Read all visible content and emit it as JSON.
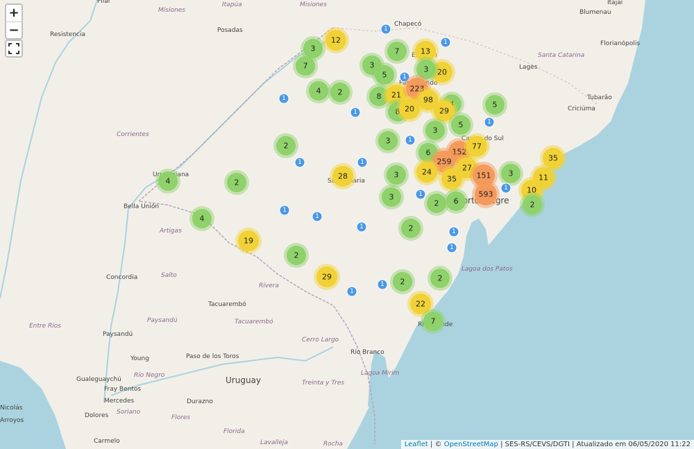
{
  "controls": {
    "zoom_in": "+",
    "zoom_out": "−"
  },
  "attribution": {
    "leaflet": "Leaflet",
    "sep1": " | © ",
    "osm": "OpenStreetMap",
    "rest": " | SES-RS/CEVS/DGTI | Atualizado em 06/05/2020 11:22"
  },
  "colors": {
    "green": "#8fd16a",
    "yellow": "#f1d236",
    "orange": "#f49a5b",
    "blue": "#4a98e6",
    "sea": "#aad3df",
    "land": "#f2efe9"
  },
  "places": [
    {
      "name": "Pilar",
      "style": "n"
    },
    {
      "name": "Misiones",
      "style": "it"
    },
    {
      "name": "Itapúa",
      "style": "it"
    },
    {
      "name": "Misiones",
      "style": "it"
    },
    {
      "name": "Chapecó",
      "style": "n"
    },
    {
      "name": "Itajaí",
      "style": "n"
    },
    {
      "name": "Blumenau",
      "style": "n"
    },
    {
      "name": "Resistencia",
      "style": "n"
    },
    {
      "name": "Posadas",
      "style": "n"
    },
    {
      "name": "Florianópolis",
      "style": "n"
    },
    {
      "name": "Santa Catarina",
      "style": "it"
    },
    {
      "name": "Lages",
      "style": "n"
    },
    {
      "name": "Tubarão",
      "style": "n"
    },
    {
      "name": "Criciúma",
      "style": "n"
    },
    {
      "name": "Corrientes",
      "style": "it"
    },
    {
      "name": "Caxias do Sul",
      "style": "n"
    },
    {
      "name": "Bella Unión",
      "style": "n"
    },
    {
      "name": "Porto Alegre",
      "style": "big"
    },
    {
      "name": "Artigas",
      "style": "it"
    },
    {
      "name": "Concordia",
      "style": "n"
    },
    {
      "name": "Salto",
      "style": "it"
    },
    {
      "name": "Rivera",
      "style": "it"
    },
    {
      "name": "Tacuarembó",
      "style": "n"
    },
    {
      "name": "Tacuarembó",
      "style": "it"
    },
    {
      "name": "Paysandú",
      "style": "it"
    },
    {
      "name": "Entre Ríos",
      "style": "it"
    },
    {
      "name": "Paysandú",
      "style": "n"
    },
    {
      "name": "Cerro Largo",
      "style": "it"
    },
    {
      "name": "Young",
      "style": "n"
    },
    {
      "name": "Paso de los Toros",
      "style": "n"
    },
    {
      "name": "Río Negro",
      "style": "it"
    },
    {
      "name": "Gualeguaychú",
      "style": "n"
    },
    {
      "name": "Fray Bentos",
      "style": "n"
    },
    {
      "name": "Mercedes",
      "style": "n"
    },
    {
      "name": "Uruguay",
      "style": "big"
    },
    {
      "name": "Río Branco",
      "style": "n"
    },
    {
      "name": "Treinta y Tres",
      "style": "it"
    },
    {
      "name": "Durazno",
      "style": "n"
    },
    {
      "name": "Soriano",
      "style": "it"
    },
    {
      "name": "Dolores",
      "style": "n"
    },
    {
      "name": "Flores",
      "style": "it"
    },
    {
      "name": "Florida",
      "style": "it"
    },
    {
      "name": "Lavalleja",
      "style": "it"
    },
    {
      "name": "Rocha",
      "style": "it"
    },
    {
      "name": "Carmelo",
      "style": "n"
    },
    {
      "name": "Lagoa dos Patos",
      "style": "it"
    },
    {
      "name": "Lagoa Mirim",
      "style": "it"
    },
    {
      "name": "Santa Maria",
      "style": "n"
    },
    {
      "name": "Passo Fundo",
      "style": "n"
    },
    {
      "name": "Erechim",
      "style": "n"
    },
    {
      "name": "Rio Grande",
      "style": "n"
    },
    {
      "name": "Uruguaiana",
      "style": "n"
    },
    {
      "name": "Nicolás",
      "style": "n"
    },
    {
      "name": "Arroyos",
      "style": "n"
    }
  ],
  "clusters": [
    {
      "count": "12",
      "color": "yellow"
    },
    {
      "count": "1",
      "color": "blue"
    },
    {
      "count": "1",
      "color": "blue"
    },
    {
      "count": "3",
      "color": "green"
    },
    {
      "count": "7",
      "color": "green"
    },
    {
      "count": "7",
      "color": "green"
    },
    {
      "count": "13",
      "color": "yellow"
    },
    {
      "count": "3",
      "color": "green"
    },
    {
      "count": "5",
      "color": "green"
    },
    {
      "count": "20",
      "color": "yellow"
    },
    {
      "count": "3",
      "color": "green"
    },
    {
      "count": "1",
      "color": "blue"
    },
    {
      "count": "4",
      "color": "green"
    },
    {
      "count": "2",
      "color": "green"
    },
    {
      "count": "8",
      "color": "green"
    },
    {
      "count": "21",
      "color": "yellow"
    },
    {
      "count": "223",
      "color": "orange"
    },
    {
      "count": "98",
      "color": "yellow"
    },
    {
      "count": "1",
      "color": "blue"
    },
    {
      "count": "8",
      "color": "green"
    },
    {
      "count": "20",
      "color": "yellow"
    },
    {
      "count": "4",
      "color": "green"
    },
    {
      "count": "29",
      "color": "yellow"
    },
    {
      "count": "5",
      "color": "green"
    },
    {
      "count": "1",
      "color": "blue"
    },
    {
      "count": "1",
      "color": "blue"
    },
    {
      "count": "5",
      "color": "green"
    },
    {
      "count": "3",
      "color": "green"
    },
    {
      "count": "2",
      "color": "green"
    },
    {
      "count": "3",
      "color": "green"
    },
    {
      "count": "1",
      "color": "blue"
    },
    {
      "count": "6",
      "color": "green"
    },
    {
      "count": "152",
      "color": "orange"
    },
    {
      "count": "77",
      "color": "yellow"
    },
    {
      "count": "259",
      "color": "orange"
    },
    {
      "count": "24",
      "color": "yellow"
    },
    {
      "count": "27",
      "color": "yellow"
    },
    {
      "count": "151",
      "color": "orange"
    },
    {
      "count": "3",
      "color": "green"
    },
    {
      "count": "35",
      "color": "yellow"
    },
    {
      "count": "1",
      "color": "blue"
    },
    {
      "count": "28",
      "color": "yellow"
    },
    {
      "count": "1",
      "color": "blue"
    },
    {
      "count": "3",
      "color": "green"
    },
    {
      "count": "35",
      "color": "yellow"
    },
    {
      "count": "11",
      "color": "yellow"
    },
    {
      "count": "4",
      "color": "green"
    },
    {
      "count": "2",
      "color": "green"
    },
    {
      "count": "1",
      "color": "blue"
    },
    {
      "count": "593",
      "color": "orange"
    },
    {
      "count": "1",
      "color": "blue"
    },
    {
      "count": "10",
      "color": "yellow"
    },
    {
      "count": "3",
      "color": "green"
    },
    {
      "count": "2",
      "color": "green"
    },
    {
      "count": "6",
      "color": "green"
    },
    {
      "count": "2",
      "color": "green"
    },
    {
      "count": "1",
      "color": "blue"
    },
    {
      "count": "1",
      "color": "blue"
    },
    {
      "count": "4",
      "color": "green"
    },
    {
      "count": "2",
      "color": "green"
    },
    {
      "count": "1",
      "color": "blue"
    },
    {
      "count": "1",
      "color": "blue"
    },
    {
      "count": "19",
      "color": "yellow"
    },
    {
      "count": "1",
      "color": "blue"
    },
    {
      "count": "2",
      "color": "green"
    },
    {
      "count": "29",
      "color": "yellow"
    },
    {
      "count": "1",
      "color": "blue"
    },
    {
      "count": "1",
      "color": "blue"
    },
    {
      "count": "2",
      "color": "green"
    },
    {
      "count": "2",
      "color": "green"
    },
    {
      "count": "22",
      "color": "yellow"
    },
    {
      "count": "7",
      "color": "green"
    }
  ]
}
